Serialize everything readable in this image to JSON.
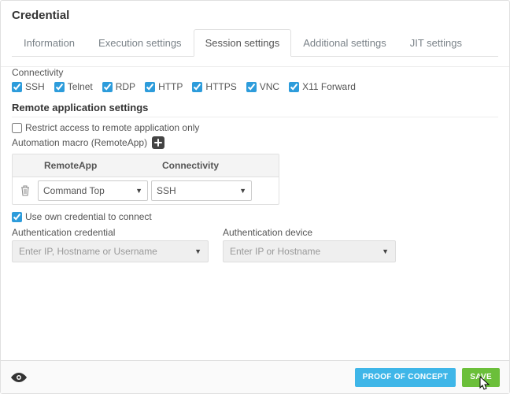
{
  "page_title": "Credential",
  "tabs": [
    {
      "label": "Information",
      "id": "tab-information"
    },
    {
      "label": "Execution settings",
      "id": "tab-execution"
    },
    {
      "label": "Session settings",
      "id": "tab-session"
    },
    {
      "label": "Additional settings",
      "id": "tab-additional"
    },
    {
      "label": "JIT settings",
      "id": "tab-jit"
    }
  ],
  "active_tab": "Session settings",
  "connectivity": {
    "label": "Connectivity",
    "options": [
      {
        "label": "SSH",
        "checked": true
      },
      {
        "label": "Telnet",
        "checked": true
      },
      {
        "label": "RDP",
        "checked": true
      },
      {
        "label": "HTTP",
        "checked": true
      },
      {
        "label": "HTTPS",
        "checked": true
      },
      {
        "label": "VNC",
        "checked": true
      },
      {
        "label": "X11 Forward",
        "checked": true
      }
    ]
  },
  "remote_app": {
    "title": "Remote application settings",
    "restrict": {
      "label": "Restrict access to remote application only",
      "checked": false
    },
    "macro_label": "Automation macro (RemoteApp)",
    "grid": {
      "headers": {
        "app": "RemoteApp",
        "conn": "Connectivity"
      },
      "row": {
        "app_value": "Command Top",
        "conn_value": "SSH"
      }
    },
    "use_own": {
      "label": "Use own credential to connect",
      "checked": true
    }
  },
  "auth_credential": {
    "label": "Authentication credential",
    "placeholder": "Enter IP, Hostname or Username"
  },
  "auth_device": {
    "label": "Authentication device",
    "placeholder": "Enter IP or Hostname"
  },
  "footer": {
    "poc": "Proof of Concept",
    "save": "Save"
  }
}
